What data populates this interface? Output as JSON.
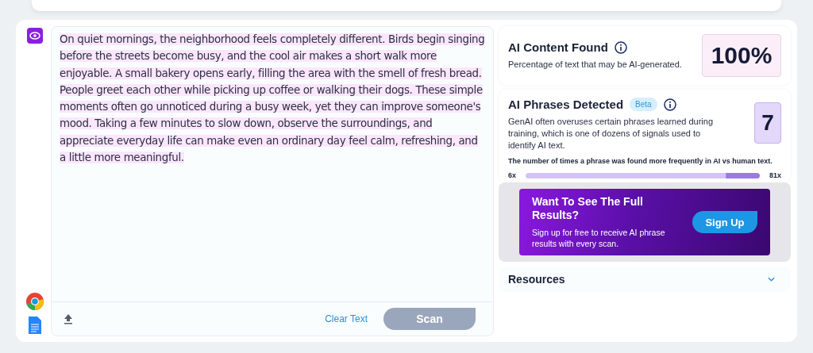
{
  "editor": {
    "text": "On quiet mornings, the neighborhood feels completely different. Birds begin singing before the streets become busy, and the cool air makes a short walk more enjoyable. A small bakery opens early, filling the area with the smell of fresh bread. People greet each other while picking up coffee or walking their dogs. These simple moments often go unnoticed during a busy week, yet they can improve someone's mood. Taking a few minutes to slow down, observe the surroundings, and appreciate everyday life can make even an ordinary day feel calm, refreshing, and a little more meaningful.",
    "highlighted": true,
    "clear_label": "Clear Text",
    "scan_label": "Scan",
    "scan_disabled": true
  },
  "ai_content": {
    "title": "AI Content Found",
    "description": "Percentage of text that may be AI-generated.",
    "value": "100%"
  },
  "ai_phrases": {
    "title": "AI Phrases Detected",
    "badge": "Beta",
    "description": "GenAI often overuses certain phrases learned during training, which is one of dozens of signals used to identify AI text.",
    "value": "7",
    "note": "The number of times a phrase was found more frequently in AI vs human text.",
    "min_label": "6x",
    "max_label": "81x"
  },
  "promo": {
    "title": "Want To See The Full Results?",
    "text": "Sign up for free to receive AI phrase results with every scan.",
    "button": "Sign Up"
  },
  "resources": {
    "title": "Resources",
    "expanded": false
  }
}
